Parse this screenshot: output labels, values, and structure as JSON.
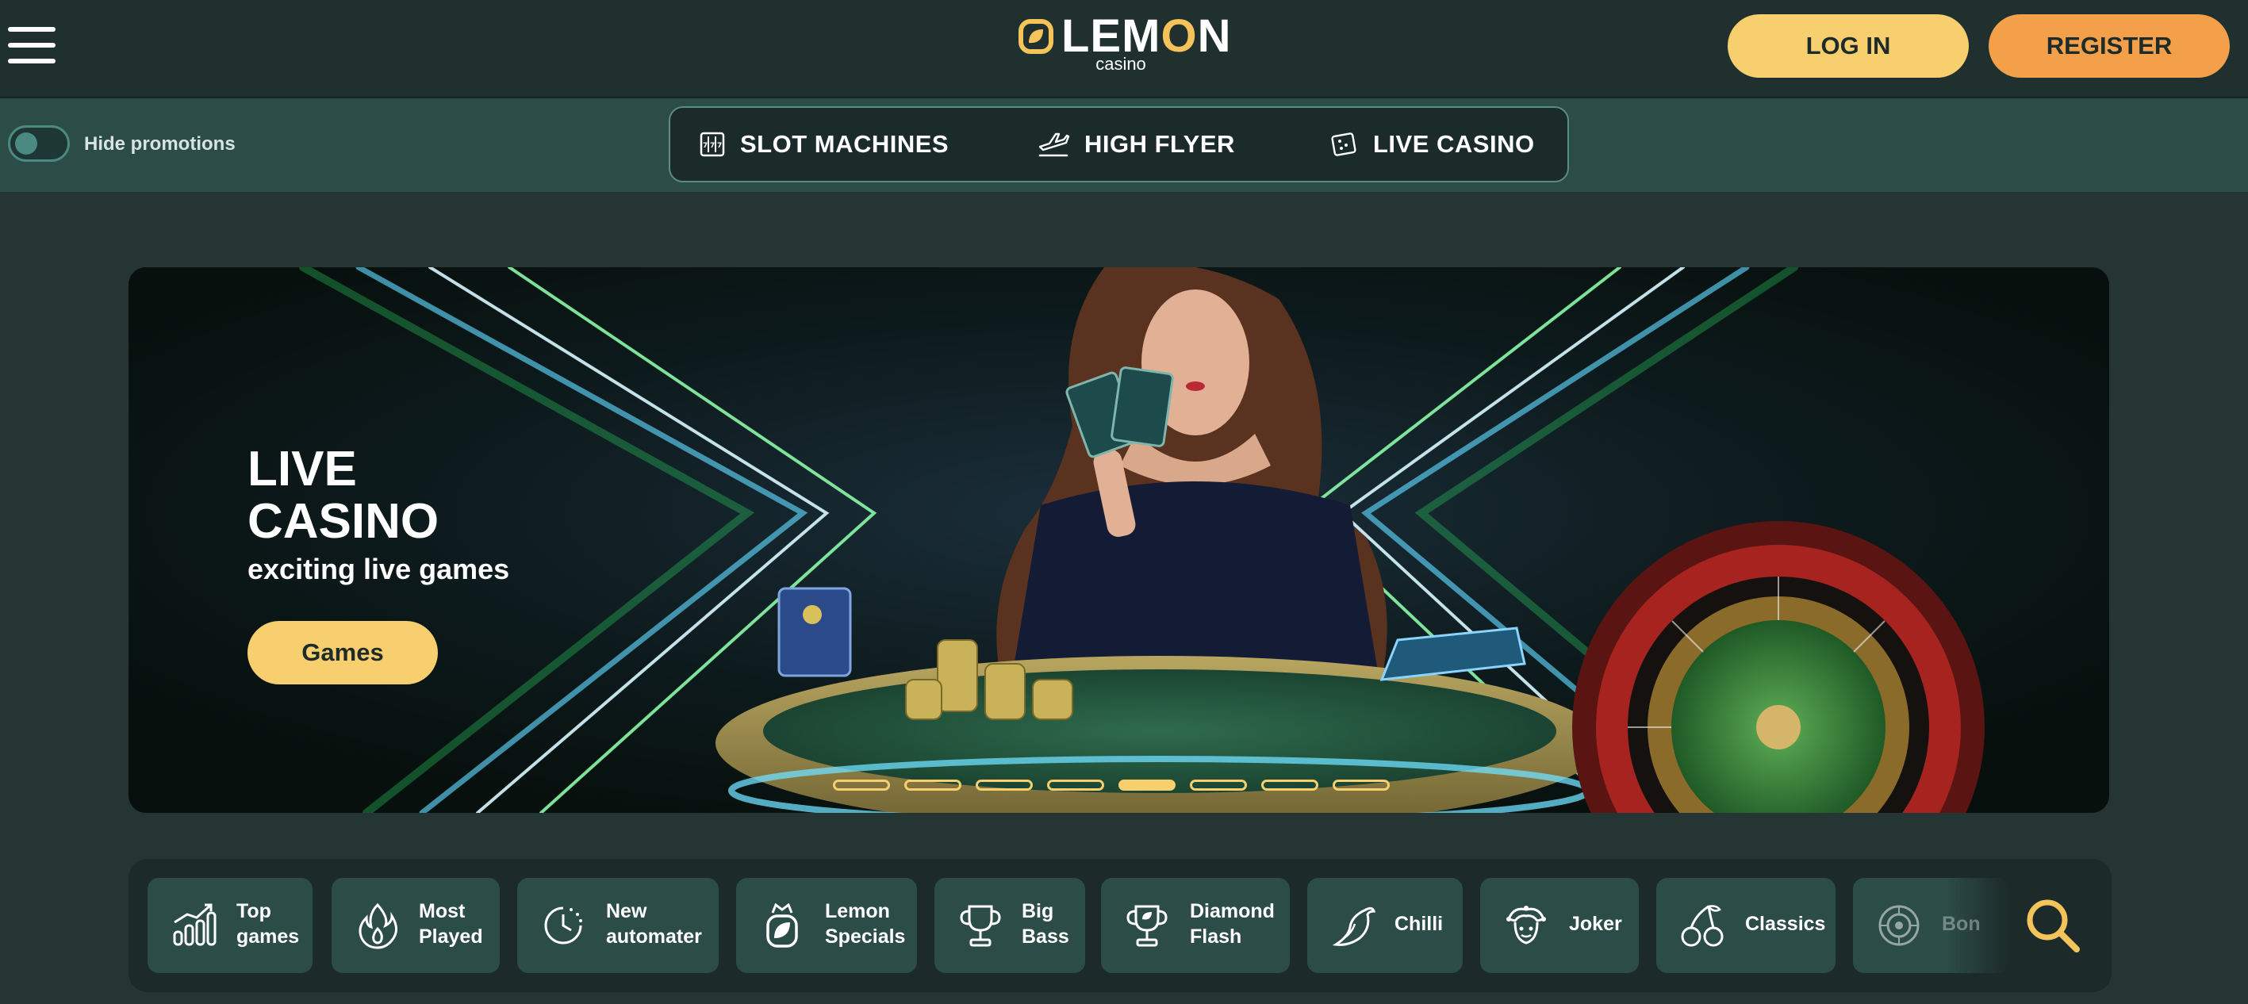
{
  "header": {
    "logo_word_prefix": "LEM",
    "logo_word_o": "O",
    "logo_word_suffix": "N",
    "logo_sub": "casino",
    "login_label": "LOG IN",
    "register_label": "REGISTER"
  },
  "promotions": {
    "toggle_label": "Hide promotions"
  },
  "nav": {
    "tabs": [
      {
        "label": "SLOT MACHINES",
        "icon": "slot-machine-icon"
      },
      {
        "label": "HIGH FLYER",
        "icon": "plane-icon"
      },
      {
        "label": "LIVE CASINO",
        "icon": "cards-icon"
      }
    ]
  },
  "banner": {
    "title_line1": "LIVE",
    "title_line2": "CASINO",
    "subtitle": "exciting live games",
    "button_label": "Games",
    "slide_count": 8,
    "active_slide": 5
  },
  "categories": [
    {
      "line1": "Top",
      "line2": "games",
      "icon": "chart-icon"
    },
    {
      "line1": "Most",
      "line2": "Played",
      "icon": "flame-icon"
    },
    {
      "line1": "New",
      "line2": "automater",
      "icon": "clock-icon"
    },
    {
      "line1": "Lemon",
      "line2": "Specials",
      "icon": "lemon-crown-icon"
    },
    {
      "line1": "Big",
      "line2": "Bass",
      "icon": "trophy-icon"
    },
    {
      "line1": "Diamond",
      "line2": "Flash",
      "icon": "trophy-icon"
    },
    {
      "line1": "Chilli",
      "line2": "",
      "icon": "chilli-icon"
    },
    {
      "line1": "Joker",
      "line2": "",
      "icon": "joker-icon"
    },
    {
      "line1": "Classics",
      "line2": "",
      "icon": "cherries-icon"
    },
    {
      "line1": "Bon",
      "line2": "",
      "icon": "bonus-wheel-icon"
    }
  ],
  "colors": {
    "header_bg": "#1f302e",
    "subbar_bg": "#2c4c48",
    "accent_yellow": "#f7cf6f",
    "accent_orange": "#f4a04a",
    "page_bg": "#243533"
  }
}
